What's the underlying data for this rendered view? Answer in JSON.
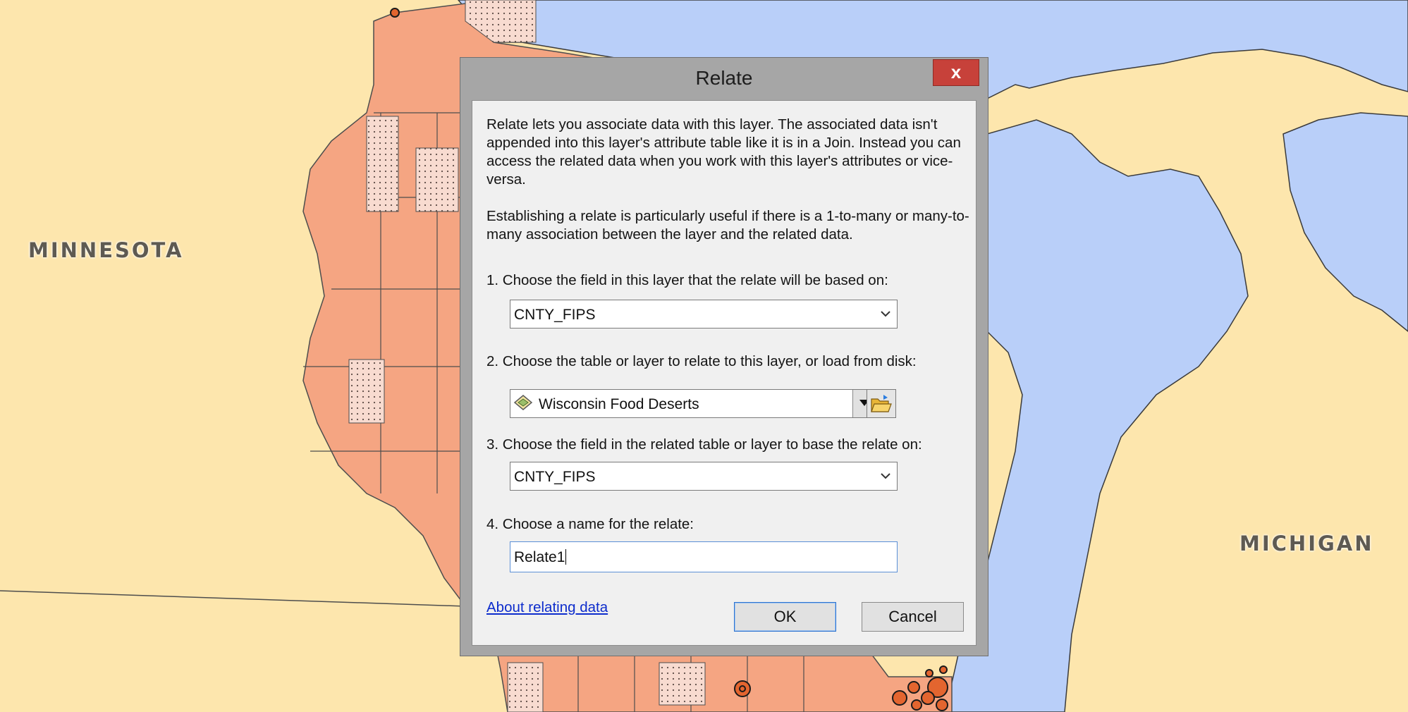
{
  "map": {
    "labels": {
      "minnesota": "MINNESOTA",
      "michigan": "MICHIGAN"
    },
    "colors": {
      "land": "#fde6ad",
      "water": "#b9cff9",
      "county_fill": "#f5a582",
      "food_desert_fill": "#f8dbd0",
      "border": "#4d4d4d"
    }
  },
  "dialog": {
    "title": "Relate",
    "close_symbol": "x",
    "description_1": "Relate lets you associate data with this layer. The associated data isn't appended into this layer's attribute table like it is in a Join. Instead you can access the related data when you work with this layer's attributes or vice-versa.",
    "description_2": "Establishing a relate is particularly useful if there is a 1-to-many or many-to-many association between the layer and the related data.",
    "step1": {
      "label": "1. Choose the field in this layer that the relate will be based on:",
      "value": "CNTY_FIPS",
      "icon": "chevron-down-icon"
    },
    "step2": {
      "label": "2. Choose the table or layer to relate to this layer, or load from disk:",
      "value": "Wisconsin Food Deserts",
      "layer_icon": "polygon-layer-icon",
      "browse_icon": "open-folder-icon"
    },
    "step3": {
      "label": "3. Choose the field in the related table or layer to base the relate on:",
      "value": "CNTY_FIPS",
      "icon": "chevron-down-icon"
    },
    "step4": {
      "label": "4. Choose a name for the relate:",
      "value": "Relate1"
    },
    "help_link": "About relating data",
    "ok_label": "OK",
    "cancel_label": "Cancel"
  }
}
